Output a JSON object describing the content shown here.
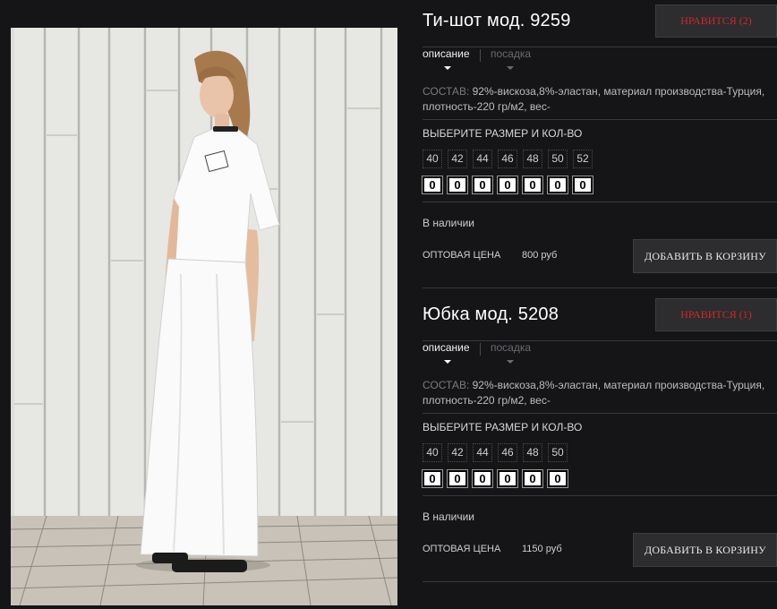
{
  "products": [
    {
      "title": "Ти-шот мод. 9259",
      "like_label": "НРАВИТСЯ",
      "like_count": "(2)",
      "tabs": [
        "описание",
        "посадка"
      ],
      "composition_label": "СОСТАВ:",
      "composition_text": "92%-вискоза,8%-эластан, материал производства-Турция, плотность-220 гр/м2, вес-",
      "size_title": "ВЫБЕРИТЕ РАЗМЕР И КОЛ-ВО",
      "sizes": [
        "40",
        "42",
        "44",
        "46",
        "48",
        "50",
        "52"
      ],
      "quantities": [
        "0",
        "0",
        "0",
        "0",
        "0",
        "0",
        "0"
      ],
      "stock": "В наличии",
      "price_label": "ОПТОВАЯ ЦЕНА",
      "price_value": "800 руб",
      "cart_label": "ДОБАВИТЬ В КОРЗИНУ"
    },
    {
      "title": "Юбка мод. 5208",
      "like_label": "НРАВИТСЯ",
      "like_count": "(1)",
      "tabs": [
        "описание",
        "посадка"
      ],
      "composition_label": "СОСТАВ:",
      "composition_text": "92%-вискоза,8%-эластан, материал производства-Турция, плотность-220 гр/м2, вес-",
      "size_title": "ВЫБЕРИТЕ РАЗМЕР И КОЛ-ВО",
      "sizes": [
        "40",
        "42",
        "44",
        "46",
        "48",
        "50"
      ],
      "quantities": [
        "0",
        "0",
        "0",
        "0",
        "0",
        "0"
      ],
      "stock": "В наличии",
      "price_label": "ОПТОВАЯ ЦЕНА",
      "price_value": "1150 руб",
      "cart_label": "ДОБАВИТЬ В КОРЗИНУ"
    }
  ],
  "colors": {
    "background": "#151417",
    "like_text": "#cc2a2a",
    "button_bg": "#2d2c2f"
  },
  "icons": {
    "tab_active_marker": "caret-down-icon",
    "tab_inactive_marker": "caret-down-icon"
  }
}
